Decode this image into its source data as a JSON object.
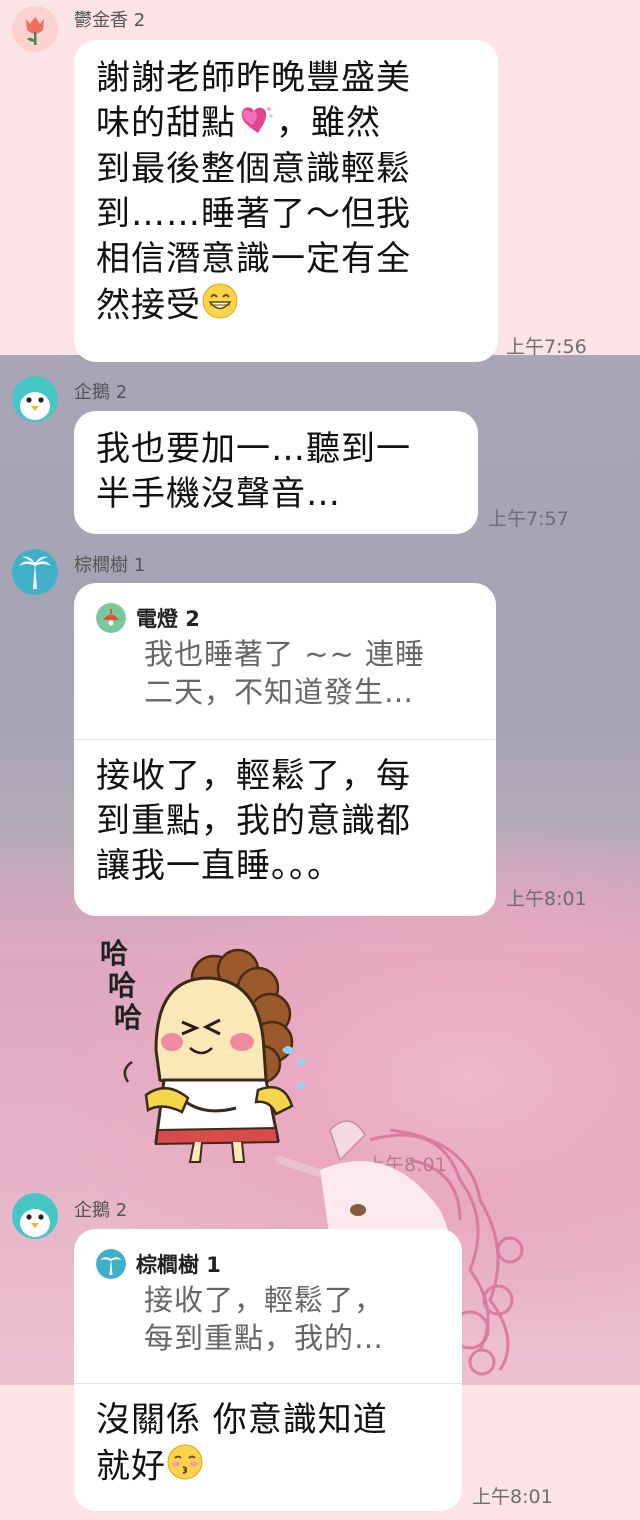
{
  "messages": [
    {
      "sender": "鬱金香 2",
      "avatar_icon": "tulip-icon",
      "text": "謝謝老師昨晚豐盛美\n味的甜點",
      "text_after_emoji": "，雖然\n到最後整個意識輕鬆\n到……睡著了～但我\n相信潛意識一定有全\n然接受",
      "time": "上午7:56"
    },
    {
      "sender": "企鵝 2",
      "avatar_icon": "penguin-icon",
      "text": "我也要加一…聽到一\n半手機沒聲音…",
      "time": "上午7:57"
    },
    {
      "sender": "棕櫚樹 1",
      "avatar_icon": "palm-tree-icon",
      "reply_to": {
        "name": "電燈 2",
        "icon": "lamp-icon",
        "text": "我也睡著了 ~~ 連睡\n二天，不知道發生…"
      },
      "text": "接收了，輕鬆了，每\n到重點，我的意識都\n讓我一直睡。。。",
      "time": "上午8:01"
    },
    {
      "sticker": "laughing-girl-sticker",
      "sticker_text": [
        "哈",
        "哈",
        "哈"
      ],
      "time": "上午8:01"
    },
    {
      "sender": "企鵝 2",
      "avatar_icon": "penguin-icon",
      "reply_to": {
        "name": "棕櫚樹 1",
        "icon": "palm-tree-icon",
        "text": "接收了，輕鬆了，\n每到重點，我的…"
      },
      "text": "沒關係 你意識知道\n就好",
      "time": "上午8:01"
    }
  ],
  "colors": {
    "tulip_bg": "#f28a7d",
    "penguin_bg": "#45c6c5",
    "palm_bg": "#3fb0c7",
    "lamp_bg": "#7bc89a"
  }
}
